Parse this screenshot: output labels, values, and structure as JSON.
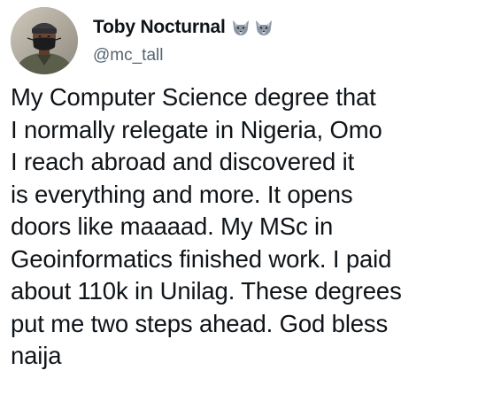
{
  "tweet": {
    "author": {
      "display_name": "Toby Nocturnal",
      "handle": "@mc_tall",
      "name_emojis": [
        "wolf-emoji",
        "wolf-emoji"
      ]
    },
    "text_lines": [
      "My Computer Science degree that",
      "I normally relegate in Nigeria, Omo",
      "I reach abroad and discovered it",
      "is everything and more. It opens",
      "doors like maaaad. My MSc in",
      "Geoinformatics finished work. I paid",
      "about 110k in Unilag. These degrees",
      "put me two steps ahead. God bless",
      "naija"
    ]
  },
  "colors": {
    "text_primary": "#0f1419",
    "text_secondary": "#536471",
    "background": "#ffffff"
  }
}
